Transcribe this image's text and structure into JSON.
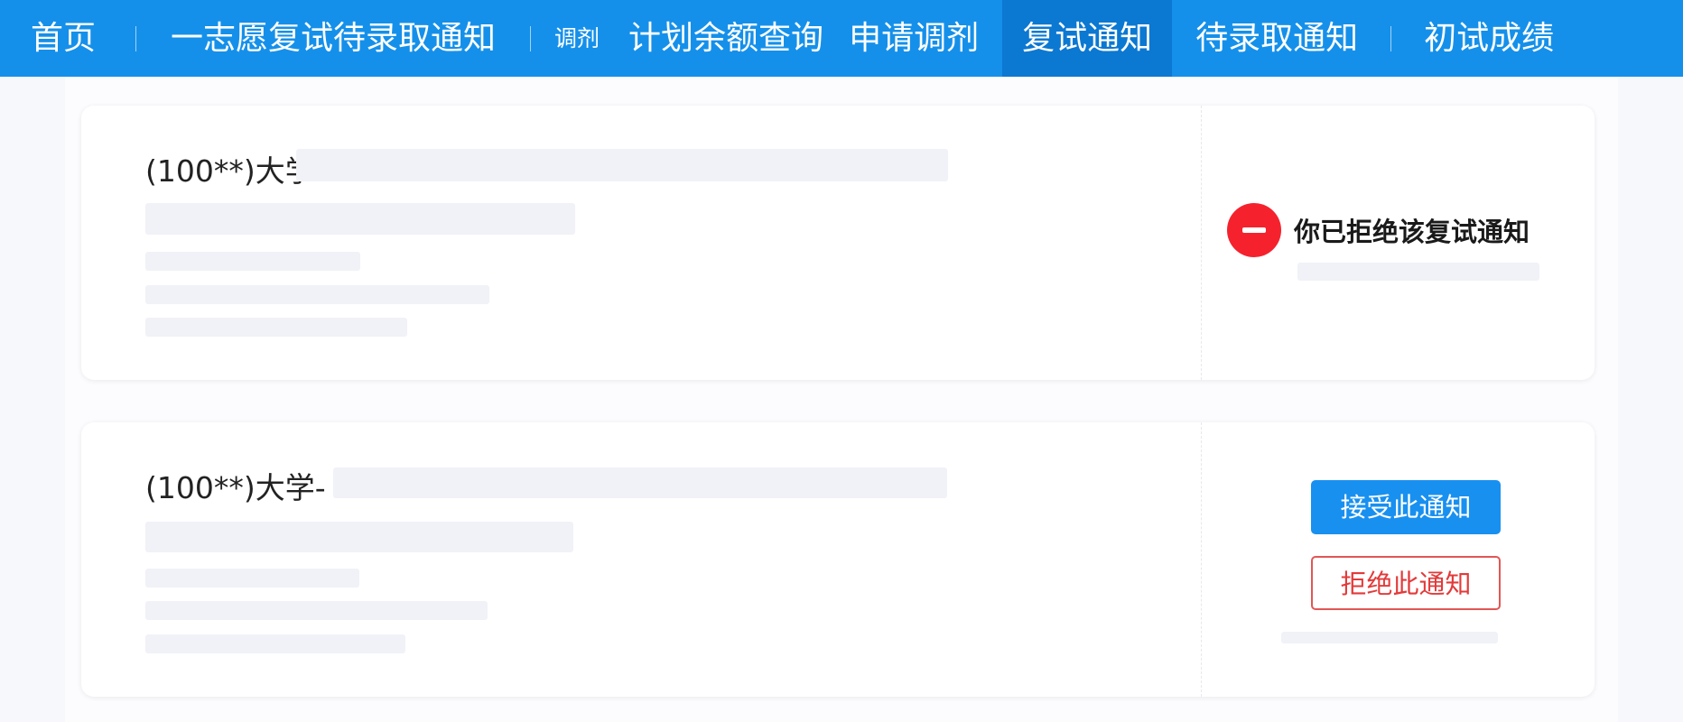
{
  "nav": {
    "items": [
      {
        "label": "首页"
      },
      {
        "label": "一志愿复试待录取通知"
      },
      {
        "label": "调剂"
      },
      {
        "label": "计划余额查询"
      },
      {
        "label": "申请调剂"
      },
      {
        "label": "复试通知"
      },
      {
        "label": "待录取通知"
      },
      {
        "label": "初试成绩"
      }
    ],
    "active_index": 5
  },
  "cards": [
    {
      "school_name": "(100**)大学-",
      "status_text": "你已拒绝该复试通知"
    },
    {
      "school_name": "(100**)大学-",
      "accept_label": "接受此通知",
      "reject_label": "拒绝此通知"
    }
  ],
  "colors": {
    "nav_bg": "#1590ea",
    "nav_active_bg": "#0b78d2",
    "reject_icon": "#f5222d",
    "accept_button": "#1890f0",
    "reject_button_border": "#e25656"
  },
  "icons": {
    "rejected_status": "minus-circle-icon"
  }
}
